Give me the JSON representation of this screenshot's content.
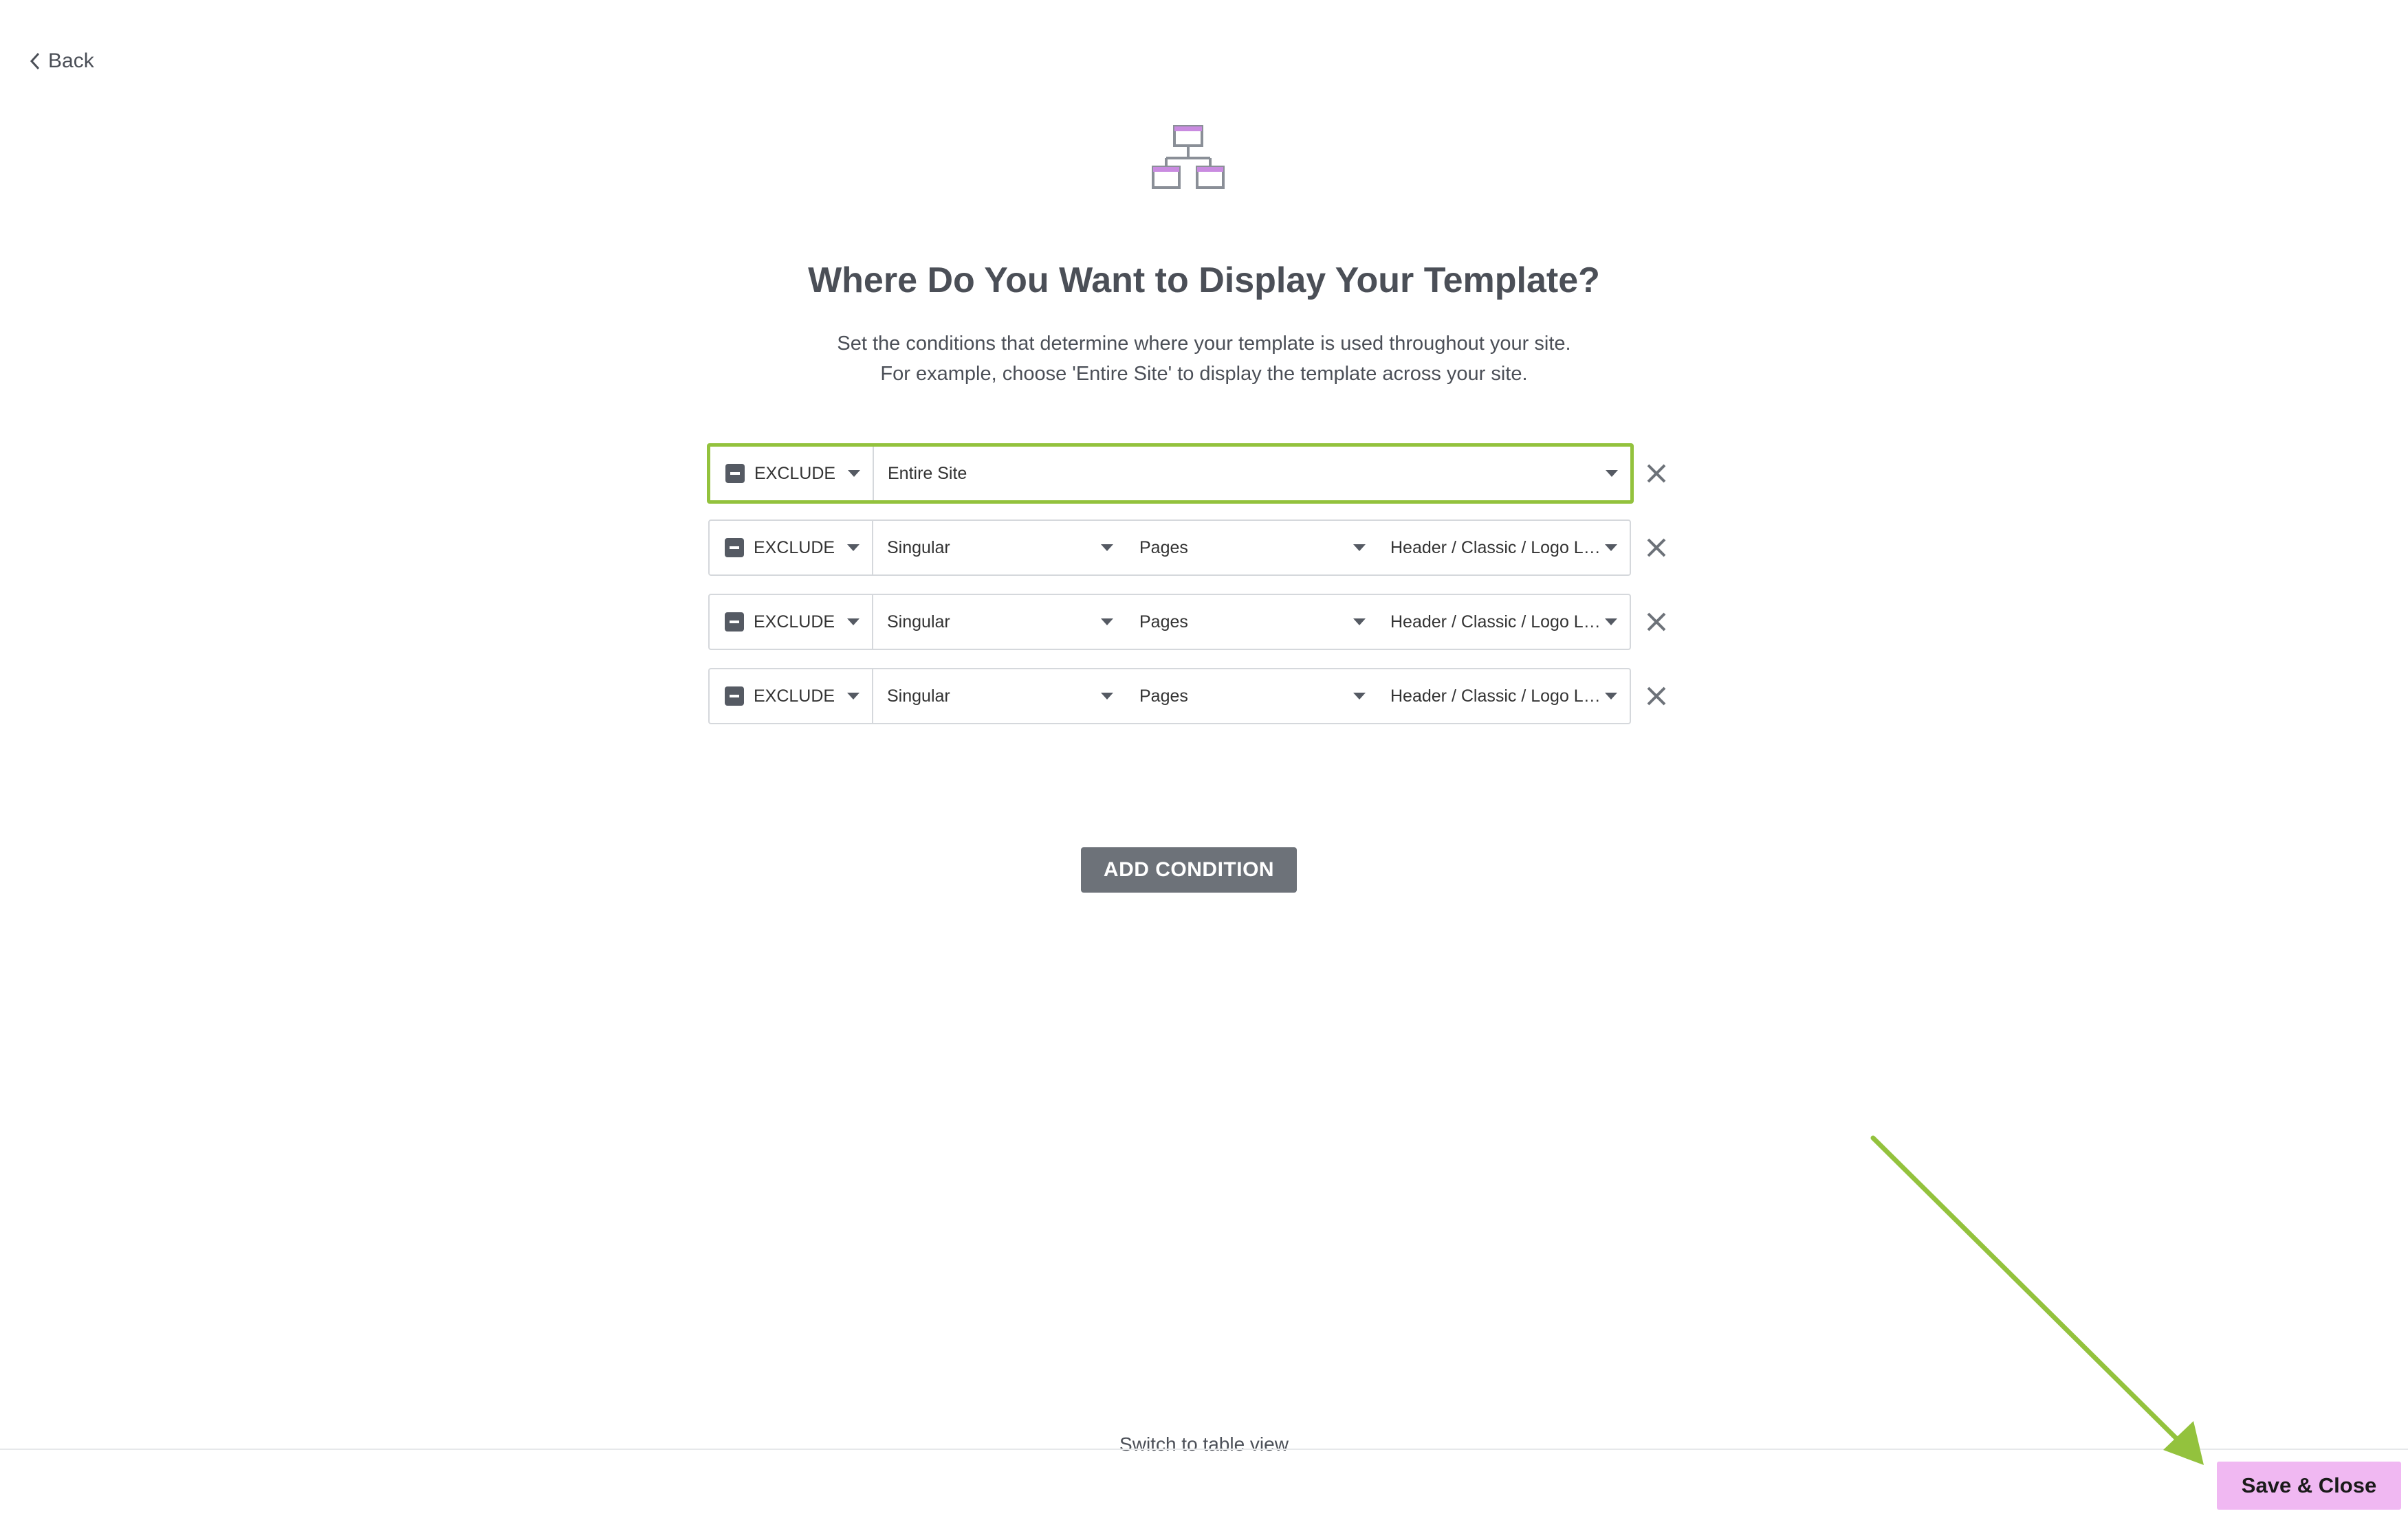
{
  "nav": {
    "back_label": "Back"
  },
  "header": {
    "title": "Where Do You Want to Display Your Template?",
    "subtitle_line1": "Set the conditions that determine where your template is used throughout your site.",
    "subtitle_line2": "For example, choose 'Entire Site' to display the template across your site."
  },
  "conditions": [
    {
      "type": "EXCLUDE",
      "main": "Entire Site",
      "active": true
    },
    {
      "type": "EXCLUDE",
      "main": "Singular",
      "sub": "Pages",
      "id": "Header / Classic / Logo Lef..."
    },
    {
      "type": "EXCLUDE",
      "main": "Singular",
      "sub": "Pages",
      "id": "Header / Classic / Logo Lef..."
    },
    {
      "type": "EXCLUDE",
      "main": "Singular",
      "sub": "Pages",
      "id": "Header / Classic / Logo Lef..."
    }
  ],
  "actions": {
    "add_condition_label": "ADD CONDITION",
    "switch_view_label": "Switch to table view",
    "save_close_label": "Save & Close"
  },
  "colors": {
    "accent_green": "#93c23d",
    "save_button_bg": "#f0b8f2",
    "add_button_bg": "#6d7279",
    "icon_purple": "#c98be0"
  },
  "icons": {
    "back": "chevron-left-icon",
    "hero": "site-structure-icon",
    "remove": "close-icon",
    "exclude": "minus-square-icon",
    "dropdown": "caret-down-icon"
  }
}
